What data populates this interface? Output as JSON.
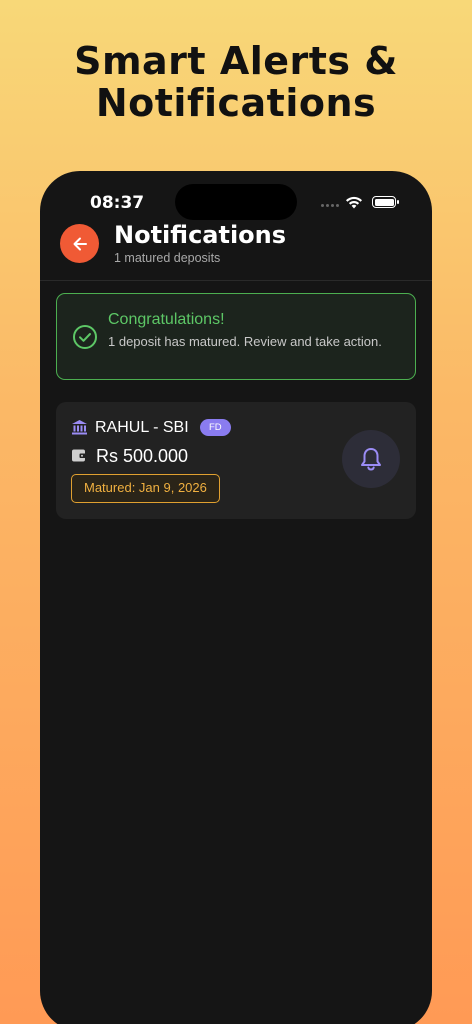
{
  "promo": {
    "headline_line1": "Smart Alerts &",
    "headline_line2": "Notifications"
  },
  "status_bar": {
    "time": "08:37"
  },
  "header": {
    "title": "Notifications",
    "subtitle": "1 matured deposits"
  },
  "congrats_card": {
    "title": "Congratulations!",
    "message": "1 deposit has matured. Review and take action."
  },
  "deposits": [
    {
      "name": "RAHUL - SBI",
      "type": "FD",
      "amount": "Rs 500.000",
      "matured_label": "Matured: Jan 9, 2026"
    }
  ],
  "colors": {
    "accent": "#f05a35",
    "success": "#5dc766",
    "badge": "#8a7cf0",
    "warning": "#f0b040",
    "background": "#151515"
  },
  "icons": {
    "back": "arrow-left-icon",
    "check": "check-circle-icon",
    "bank": "bank-icon",
    "wallet": "wallet-icon",
    "bell": "bell-icon"
  }
}
